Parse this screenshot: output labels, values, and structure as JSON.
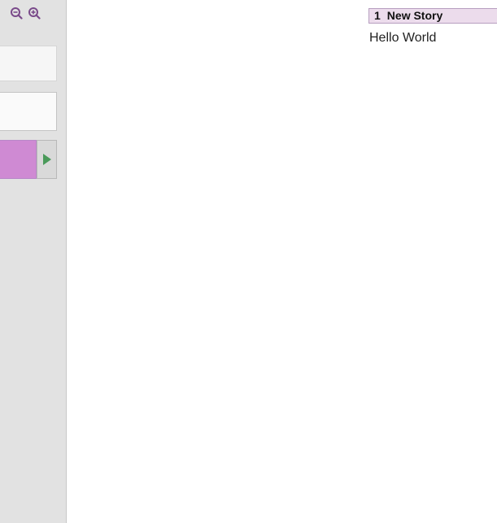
{
  "colors": {
    "sidebar_bg": "#e2e2e2",
    "swatch": "#cf8ad3",
    "passage_header_bg": "#ecdcec",
    "play_arrow": "#4a9a5a"
  },
  "zoom": {
    "zoom_out_icon": "zoom-out-icon",
    "zoom_in_icon": "zoom-in-icon"
  },
  "passage": {
    "number": "1",
    "title": "New Story",
    "text": "Hello World"
  }
}
